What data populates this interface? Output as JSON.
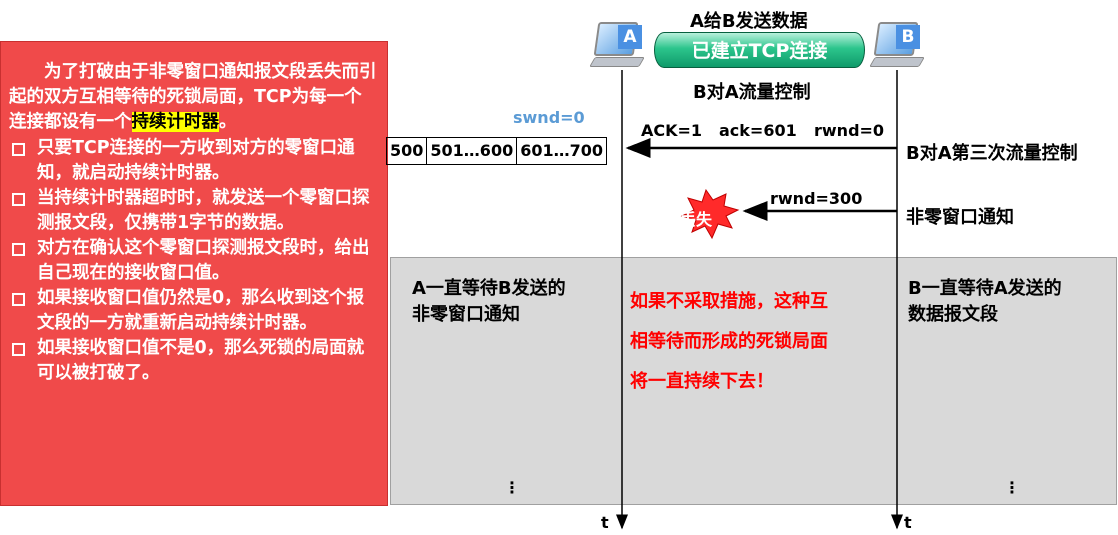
{
  "intro": {
    "text_before": "为了打破由于非零窗口通知报文段丢失而引起的双方互相等待的死锁局面，TCP为每一个连接都设有一个",
    "highlight": "持续计时器",
    "text_after": "。"
  },
  "bullets": [
    "只要TCP连接的一方收到对方的零窗口通知，就启动持续计时器。",
    "当持续计时器超时时，就发送一个零窗口探测报文段，仅携带1字节的数据。",
    "对方在确认这个零窗口探测报文段时，给出自己现在的接收窗口值。",
    "如果接收窗口值仍然是0，那么收到这个报文段的一方就重新启动持续计时器。",
    "如果接收窗口值不是0，那么死锁的局面就可以被打破了。"
  ],
  "header": {
    "send_title": "A给B发送数据",
    "connection_label": "已建立TCP连接",
    "flow_control_label": "B对A流量控制"
  },
  "hosts": {
    "a": "A",
    "b": "B"
  },
  "swnd_label": "swnd=0",
  "buffer_cells": [
    "500",
    "501…600",
    "601…700"
  ],
  "messages": {
    "ack": "ACK=1",
    "ack_num": "ack=601",
    "rwnd0": "rwnd=0",
    "third_control": "B对A第三次流量控制",
    "rwnd300": "rwnd=300",
    "nonzero_notice": "非零窗口通知",
    "lost": "丢失"
  },
  "gray": {
    "a_wait": [
      "A一直等待B发送的",
      "非零窗口通知"
    ],
    "deadlock": [
      "如果不采取措施，这种互",
      "相等待而形成的死锁局面",
      "将一直持续下去！"
    ],
    "b_wait": [
      "B一直等待A发送的",
      "数据报文段"
    ],
    "ellipsis": "⋮"
  },
  "axis_label": "t",
  "colors": {
    "panel_red": "#f04a4a",
    "highlight": "#ffff00",
    "gray_panel": "#d9d9d9",
    "deadlock_text": "#ff0000",
    "swnd": "#5b9bd5",
    "badge": "#4a90e2",
    "burst": "#ff2a2a"
  }
}
